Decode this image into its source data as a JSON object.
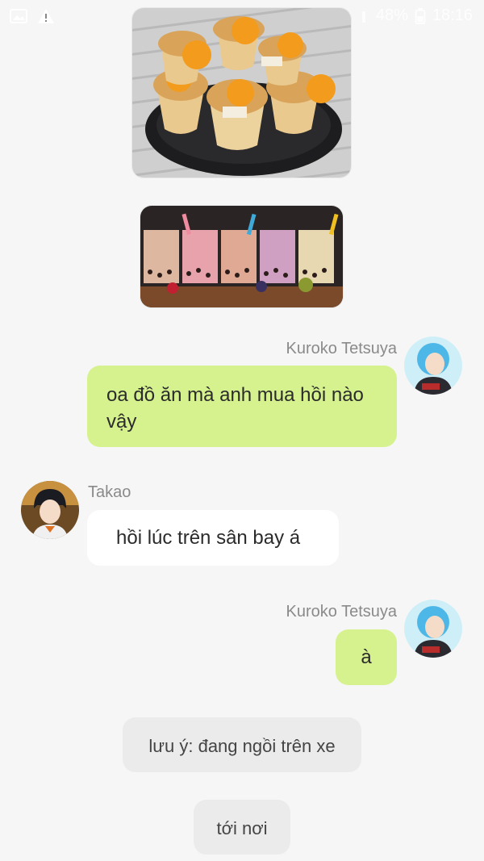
{
  "status_bar": {
    "battery": "48%",
    "time": "18:16",
    "icons": [
      "image-icon",
      "warning-icon",
      "wifi-icon",
      "signal-icon",
      "battery-icon"
    ]
  },
  "images": [
    {
      "name": "food-image",
      "description": "muffin tarts"
    },
    {
      "name": "drinks-image",
      "description": "bubble tea glasses"
    }
  ],
  "messages": [
    {
      "sender": "Kuroko Tetsuya",
      "text": "oa đồ ăn mà anh mua hồi nào vậy",
      "side": "right"
    },
    {
      "sender": "Takao",
      "text": "hồi lúc trên sân bay á",
      "side": "left"
    },
    {
      "sender": "Kuroko Tetsuya",
      "text": "à",
      "side": "right"
    }
  ],
  "system_messages": [
    "lưu ý: đang ngồi trên xe",
    "tới nơi"
  ],
  "colors": {
    "outgoing_bubble": "#d6f28e",
    "incoming_bubble": "#ffffff",
    "system_bubble": "#ebebeb",
    "background": "#f6f6f6"
  }
}
